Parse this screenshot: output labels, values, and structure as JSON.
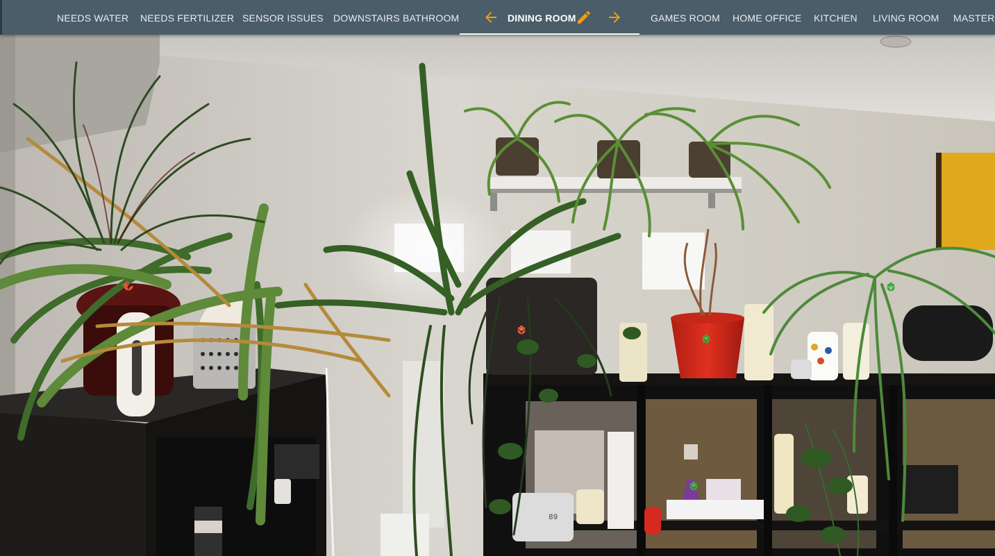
{
  "tabs": {
    "needs_water": "NEEDS WATER",
    "needs_fertilizer": "NEEDS FERTILIZER",
    "sensor_issues": "SENSOR ISSUES",
    "downstairs_bathroom": "DOWNSTAIRS BATHROOM",
    "dining_room": "DINING ROOM",
    "games_room": "GAMES ROOM",
    "home_office": "HOME OFFICE",
    "kitchen": "KITCHEN",
    "living_room": "LIVING ROOM",
    "master": "MASTER B"
  },
  "active_tab": "dining_room",
  "icons": {
    "prev": "arrow-left-icon",
    "edit": "pencil-icon",
    "next": "arrow-right-icon",
    "plant_marker": "flower-icon"
  },
  "colors": {
    "topbar": "#4a5d69",
    "accent": "#f39c12",
    "marker_problem": "#e0553a",
    "marker_ok": "#3aa83a"
  },
  "markers": [
    {
      "id": "plant-1",
      "status": "problem"
    },
    {
      "id": "plant-2",
      "status": "problem"
    },
    {
      "id": "plant-3",
      "status": "ok"
    },
    {
      "id": "plant-4",
      "status": "ok"
    },
    {
      "id": "plant-5",
      "status": "ok"
    }
  ]
}
